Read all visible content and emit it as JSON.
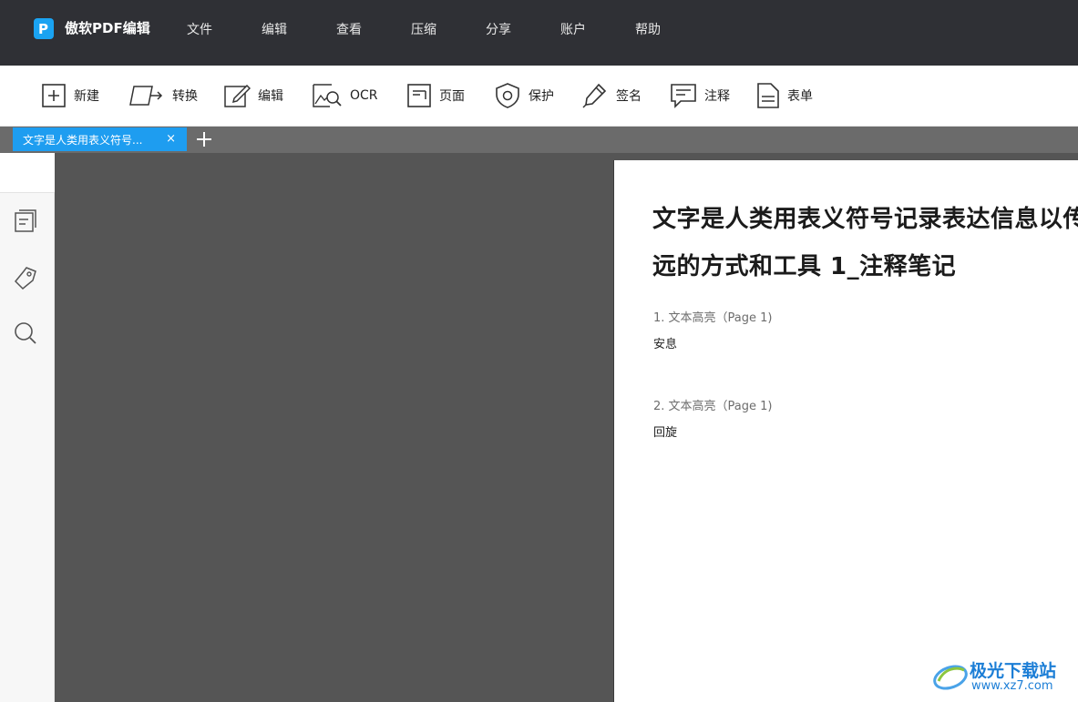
{
  "app": {
    "name": "傲软PDF编辑",
    "menu": [
      "文件",
      "编辑",
      "查看",
      "压缩",
      "分享",
      "账户",
      "帮助"
    ]
  },
  "toolbar": {
    "new": "新建",
    "convert": "转换",
    "edit": "编辑",
    "ocr": "OCR",
    "page": "页面",
    "protect": "保护",
    "sign": "签名",
    "annotate": "注释",
    "form": "表单"
  },
  "tabs": [
    {
      "title": "文字是人类用表义符号...",
      "close": "×"
    }
  ],
  "document": {
    "title_line1": "文字是人类用表义符号记录表达信息以传之久",
    "title_line2": "远的方式和工具 1_注释笔记",
    "annotations": [
      {
        "heading": "1. 文本高亮（Page 1)",
        "text": "安息"
      },
      {
        "heading": "2. 文本高亮（Page 1)",
        "text": "回旋"
      }
    ]
  },
  "watermark": {
    "name": "极光下载站",
    "url": "www.xz7.com"
  },
  "colors": {
    "titlebar": "#2f3035",
    "accent": "#1e9df0",
    "canvas": "#555555"
  }
}
